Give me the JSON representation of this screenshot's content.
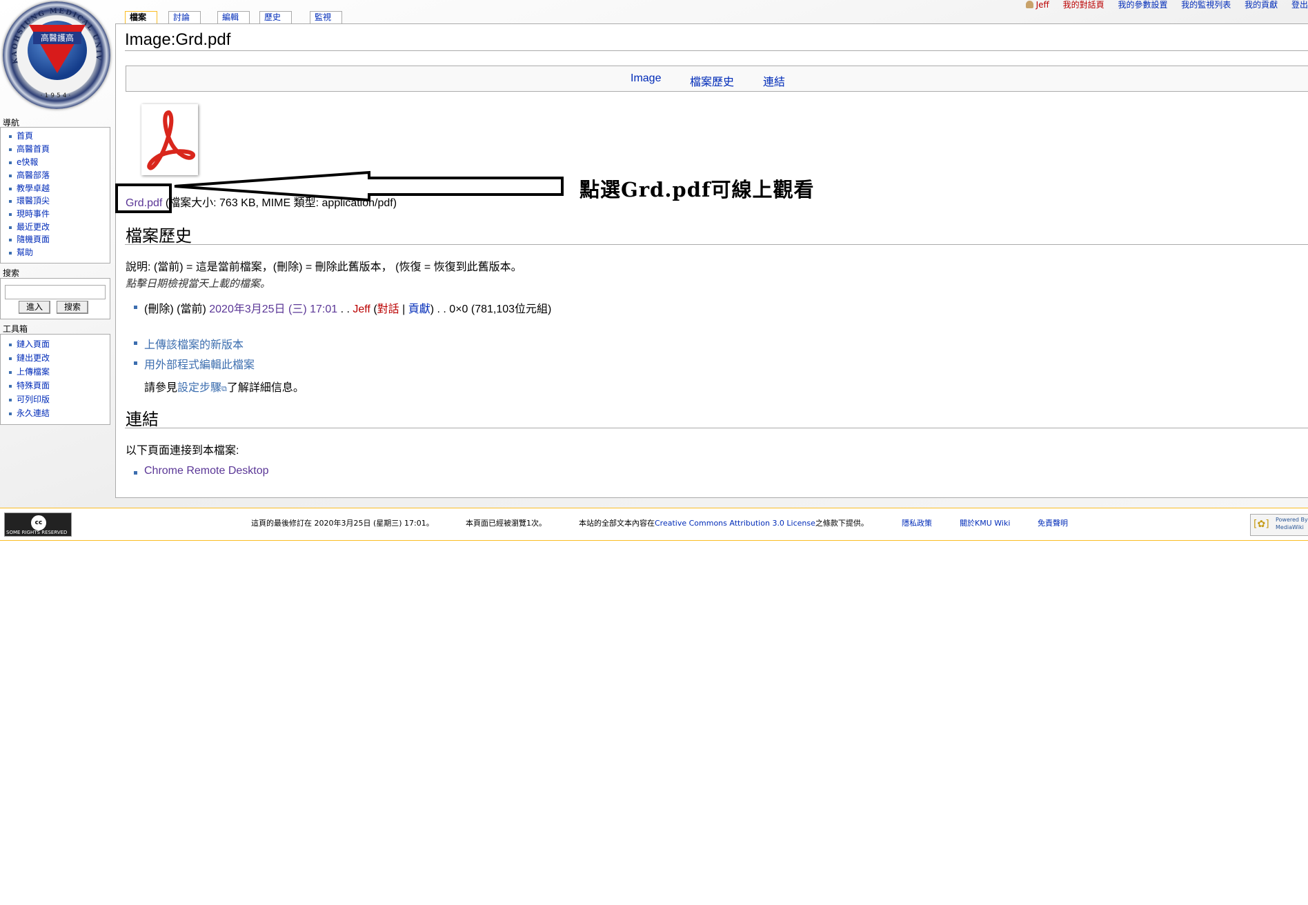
{
  "personal_tools": {
    "user": "Jeff",
    "talk": "我的對話頁",
    "prefs": "我的參數設置",
    "watchlist": "我的監視列表",
    "contribs": "我的貢獻",
    "logout": "登出"
  },
  "tabs": [
    {
      "label": "檔案"
    },
    {
      "label": "討論"
    },
    {
      "label": "編輯"
    },
    {
      "label": "歷史"
    },
    {
      "label": "監視"
    }
  ],
  "logo": {
    "band": "高醫護高",
    "ring": "KAOHSIUNG MEDICAL UNIVERSITY",
    "year": "·1954·"
  },
  "page": {
    "title": "Image:Grd.pdf",
    "toc": {
      "image": "Image",
      "history": "檔案歷史",
      "links": "連結"
    },
    "file": {
      "name": "Grd.pdf",
      "info": "(檔案大小: 763 KB, MIME 類型: application/pdf)"
    },
    "annotation": "點選Grd.pdf可線上觀看",
    "history": {
      "heading": "檔案歷史",
      "legend": "說明: (當前) = 這是當前檔案，(刪除) = 刪除此舊版本， (恢復 = 恢復到此舊版本。",
      "hint": "點擊日期檢視當天上載的檔案。",
      "entry": {
        "del": "(刪除)",
        "cur": "(當前)",
        "date": "2020年3月25日 (三) 17:01",
        "sep": " . . ",
        "user": "Jeff",
        "open": " (",
        "talk": "對話",
        "bar": " | ",
        "contribs": "貢獻",
        "close": ")",
        "tail": " . . 0×0 (781,103位元組)"
      }
    },
    "actions": {
      "upload": "上傳該檔案的新版本",
      "edit_external": "用外部程式編輯此檔案",
      "see_pre": "請參見",
      "see_link": "設定步驟",
      "see_post": "了解詳細信息。"
    },
    "links": {
      "heading": "連結",
      "intro": "以下頁面連接到本檔案:",
      "items": [
        "Chrome Remote Desktop"
      ]
    }
  },
  "sidebar": {
    "nav_heading": "導航",
    "nav": [
      "首頁",
      "高醫首頁",
      "e快報",
      "高醫部落",
      "教學卓越",
      "環醫頂尖",
      "現時事件",
      "最近更改",
      "隨機頁面",
      "幫助"
    ],
    "search_heading": "搜索",
    "search_value": "",
    "go": "進入",
    "search": "搜索",
    "toolbox_heading": "工具箱",
    "toolbox": [
      "鏈入頁面",
      "鏈出更改",
      "上傳檔案",
      "特殊頁面",
      "可列印版",
      "永久連結"
    ]
  },
  "footer": {
    "cc": "SOME RIGHTS RESERVED",
    "lastmod": "這頁的最後修訂在 2020年3月25日 (星期三) 17:01。",
    "views": "本頁面已經被瀏覽1次。",
    "license_pre": "本站的全部文本內容在",
    "license_link": "Creative Commons Attribution 3.0 License",
    "license_post": "之條款下提供。",
    "privacy": "隱私政策",
    "about": "關於KMU Wiki",
    "disclaimer": "免責聲明",
    "mw": "Powered By MediaWiki"
  },
  "colors": {
    "link": "#002bb8",
    "visited": "#5a3696",
    "new": "#ba0000",
    "tab_selected": "#fabd23"
  }
}
